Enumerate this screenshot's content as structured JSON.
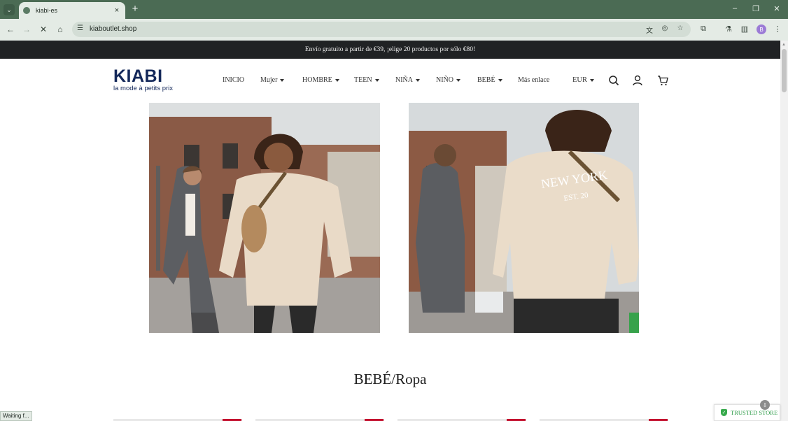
{
  "browser": {
    "tab_title": "kiabi-es",
    "url": "kiaboutlet.shop",
    "profile_initial": "B",
    "status_text": "Waiting f..."
  },
  "announcement": "Envío gratuito a partir de €39, ¡elige 20 productos por sólo €80!",
  "logo": {
    "wordmark": "KIABI",
    "tagline": "la mode à petits prix"
  },
  "nav": {
    "items": [
      {
        "label": "INICIO",
        "dropdown": false
      },
      {
        "label": "Mujer",
        "dropdown": true
      },
      {
        "label": "HOMBRE",
        "dropdown": true
      },
      {
        "label": "TEEN",
        "dropdown": true
      },
      {
        "label": "NIÑA",
        "dropdown": true
      },
      {
        "label": "NIÑO",
        "dropdown": true
      },
      {
        "label": "BEBÉ",
        "dropdown": true
      },
      {
        "label": "Más enlace",
        "dropdown": false
      }
    ],
    "currency": "EUR"
  },
  "icons": {
    "search": "search-icon",
    "account": "user-icon",
    "cart": "cart-icon"
  },
  "hero_images": {
    "left": {
      "alt_name": "hero-image-front"
    },
    "right": {
      "alt_name": "hero-image-back",
      "print_text": "NEW YORK",
      "print_sub": "EST. 20"
    }
  },
  "section": {
    "title": "BEBÉ/Ropa"
  },
  "trusted_badge": "TRUSTED STORE",
  "colors": {
    "chrome": "#4b6b54",
    "toolbar": "#e4ebe5",
    "announce_bg": "#202224",
    "logo": "#14285a",
    "accent_red": "#c3102e",
    "trusted_green": "#2a9a45"
  }
}
